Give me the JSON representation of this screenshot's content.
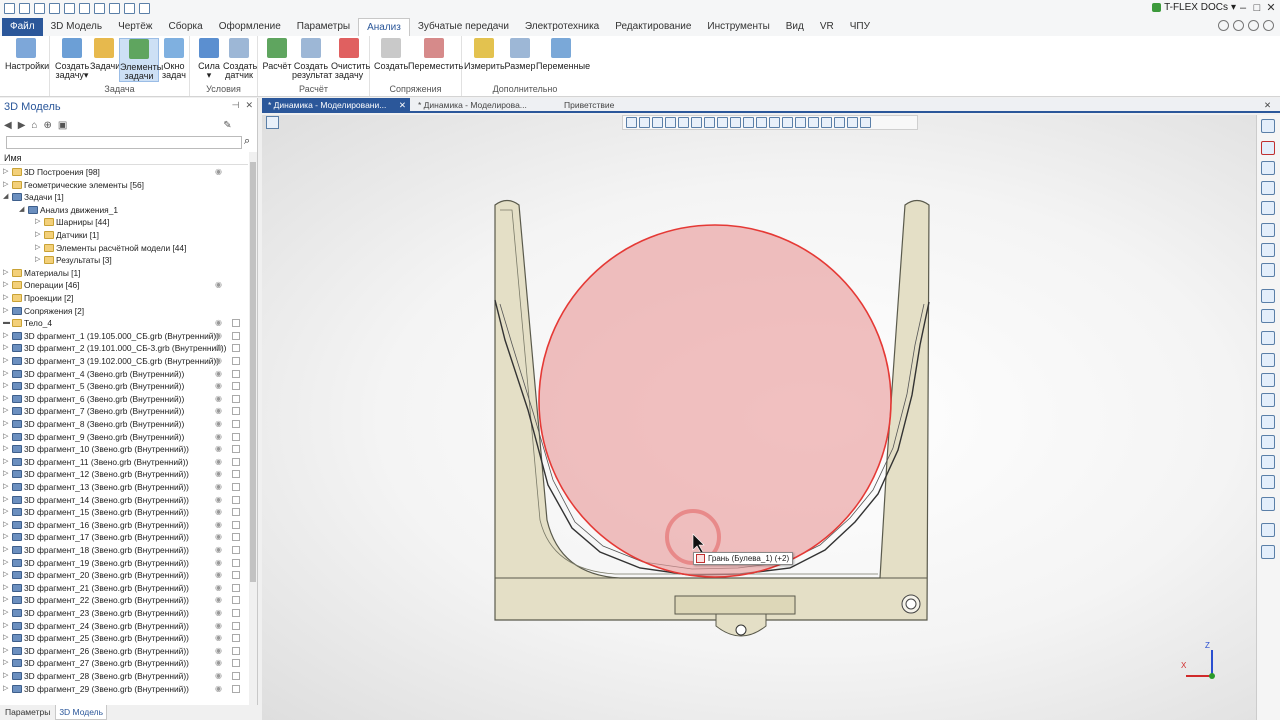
{
  "app": {
    "brand": "T-FLEX DOCs",
    "brand_arrow": "▾"
  },
  "menu_tabs": [
    "Файл",
    "3D Модель",
    "Чертёж",
    "Сборка",
    "Оформление",
    "Параметры",
    "Анализ",
    "Зубчатые передачи",
    "Электротехника",
    "Редактирование",
    "Инструменты",
    "Вид",
    "VR",
    "ЧПУ"
  ],
  "active_tab": "Анализ",
  "ribbon": {
    "settings": "Настройки",
    "create_task": "Создать задачу",
    "create_task_arrow": "▾",
    "tasks": "Задачи",
    "task_elements": "Элементы задачи",
    "task_window": "Окно задач",
    "group_task": "Задача",
    "force": "Сила",
    "force_arrow": "▾",
    "create_sensor": "Создать датчик",
    "group_conditions": "Условия",
    "calculation": "Расчёт",
    "create_result": "Создать результат",
    "clear_task": "Очистить задачу",
    "group_calc": "Расчёт",
    "create": "Создать",
    "move": "Переместить",
    "group_mates": "Сопряжения",
    "measure": "Измерить",
    "size": "Размер",
    "variables": "Переменные",
    "group_extra": "Дополнительно"
  },
  "left_panel": {
    "title": "3D Модель",
    "pin": "⊣",
    "close": "✕",
    "column_name": "Имя",
    "tree": [
      {
        "level": 0,
        "exp": "▷",
        "icon": "fold",
        "text": "3D Построения [98]",
        "eye": true,
        "doc": false
      },
      {
        "level": 0,
        "exp": "▷",
        "icon": "fold",
        "text": "Геометрические элементы [56]",
        "eye": false,
        "doc": false
      },
      {
        "level": 0,
        "exp": "◢",
        "icon": "frag",
        "text": "Задачи [1]",
        "eye": false,
        "doc": false
      },
      {
        "level": 1,
        "exp": "◢",
        "icon": "frag",
        "text": "Анализ движения_1",
        "eye": false,
        "doc": false
      },
      {
        "level": 2,
        "exp": "▷",
        "icon": "fold",
        "text": "Шарниры [44]",
        "eye": false,
        "doc": false
      },
      {
        "level": 2,
        "exp": "▷",
        "icon": "fold",
        "text": "Датчики [1]",
        "eye": false,
        "doc": false
      },
      {
        "level": 2,
        "exp": "▷",
        "icon": "fold",
        "text": "Элементы расчётной модели [44]",
        "eye": false,
        "doc": false
      },
      {
        "level": 2,
        "exp": "▷",
        "icon": "fold",
        "text": "Результаты [3]",
        "eye": false,
        "doc": false
      },
      {
        "level": 0,
        "exp": "▷",
        "icon": "fold",
        "text": "Материалы [1]",
        "eye": false,
        "doc": false
      },
      {
        "level": 0,
        "exp": "▷",
        "icon": "fold",
        "text": "Операции [46]",
        "eye": true,
        "doc": false
      },
      {
        "level": 0,
        "exp": "▷",
        "icon": "fold",
        "text": "Проекции [2]",
        "eye": false,
        "doc": false
      },
      {
        "level": 0,
        "exp": "▷",
        "icon": "frag",
        "text": "Сопряжения [2]",
        "eye": false,
        "doc": false
      },
      {
        "level": 0,
        "exp": "▬",
        "icon": "fold",
        "text": "Тело_4",
        "eye": true,
        "doc": true
      },
      {
        "level": 0,
        "exp": "▷",
        "icon": "frag",
        "text": "3D фрагмент_1 (19.105.000_СБ.grb (Внутренний))",
        "eye": true,
        "doc": true
      },
      {
        "level": 0,
        "exp": "▷",
        "icon": "frag",
        "text": "3D фрагмент_2 (19.101.000_СБ-3.grb (Внутренний))",
        "eye": true,
        "doc": true
      },
      {
        "level": 0,
        "exp": "▷",
        "icon": "frag",
        "text": "3D фрагмент_3 (19.102.000_СБ.grb (Внутренний))",
        "eye": true,
        "doc": true
      },
      {
        "level": 0,
        "exp": "▷",
        "icon": "frag",
        "text": "3D фрагмент_4 (Звено.grb (Внутренний))",
        "eye": true,
        "doc": true
      },
      {
        "level": 0,
        "exp": "▷",
        "icon": "frag",
        "text": "3D фрагмент_5 (Звено.grb (Внутренний))",
        "eye": true,
        "doc": true
      },
      {
        "level": 0,
        "exp": "▷",
        "icon": "frag",
        "text": "3D фрагмент_6 (Звено.grb (Внутренний))",
        "eye": true,
        "doc": true
      },
      {
        "level": 0,
        "exp": "▷",
        "icon": "frag",
        "text": "3D фрагмент_7 (Звено.grb (Внутренний))",
        "eye": true,
        "doc": true
      },
      {
        "level": 0,
        "exp": "▷",
        "icon": "frag",
        "text": "3D фрагмент_8 (Звено.grb (Внутренний))",
        "eye": true,
        "doc": true
      },
      {
        "level": 0,
        "exp": "▷",
        "icon": "frag",
        "text": "3D фрагмент_9 (Звено.grb (Внутренний))",
        "eye": true,
        "doc": true
      },
      {
        "level": 0,
        "exp": "▷",
        "icon": "frag",
        "text": "3D фрагмент_10 (Звено.grb (Внутренний))",
        "eye": true,
        "doc": true
      },
      {
        "level": 0,
        "exp": "▷",
        "icon": "frag",
        "text": "3D фрагмент_11 (Звено.grb (Внутренний))",
        "eye": true,
        "doc": true
      },
      {
        "level": 0,
        "exp": "▷",
        "icon": "frag",
        "text": "3D фрагмент_12 (Звено.grb (Внутренний))",
        "eye": true,
        "doc": true
      },
      {
        "level": 0,
        "exp": "▷",
        "icon": "frag",
        "text": "3D фрагмент_13 (Звено.grb (Внутренний))",
        "eye": true,
        "doc": true
      },
      {
        "level": 0,
        "exp": "▷",
        "icon": "frag",
        "text": "3D фрагмент_14 (Звено.grb (Внутренний))",
        "eye": true,
        "doc": true
      },
      {
        "level": 0,
        "exp": "▷",
        "icon": "frag",
        "text": "3D фрагмент_15 (Звено.grb (Внутренний))",
        "eye": true,
        "doc": true
      },
      {
        "level": 0,
        "exp": "▷",
        "icon": "frag",
        "text": "3D фрагмент_16 (Звено.grb (Внутренний))",
        "eye": true,
        "doc": true
      },
      {
        "level": 0,
        "exp": "▷",
        "icon": "frag",
        "text": "3D фрагмент_17 (Звено.grb (Внутренний))",
        "eye": true,
        "doc": true
      },
      {
        "level": 0,
        "exp": "▷",
        "icon": "frag",
        "text": "3D фрагмент_18 (Звено.grb (Внутренний))",
        "eye": true,
        "doc": true
      },
      {
        "level": 0,
        "exp": "▷",
        "icon": "frag",
        "text": "3D фрагмент_19 (Звено.grb (Внутренний))",
        "eye": true,
        "doc": true
      },
      {
        "level": 0,
        "exp": "▷",
        "icon": "frag",
        "text": "3D фрагмент_20 (Звено.grb (Внутренний))",
        "eye": true,
        "doc": true
      },
      {
        "level": 0,
        "exp": "▷",
        "icon": "frag",
        "text": "3D фрагмент_21 (Звено.grb (Внутренний))",
        "eye": true,
        "doc": true
      },
      {
        "level": 0,
        "exp": "▷",
        "icon": "frag",
        "text": "3D фрагмент_22 (Звено.grb (Внутренний))",
        "eye": true,
        "doc": true
      },
      {
        "level": 0,
        "exp": "▷",
        "icon": "frag",
        "text": "3D фрагмент_23 (Звено.grb (Внутренний))",
        "eye": true,
        "doc": true
      },
      {
        "level": 0,
        "exp": "▷",
        "icon": "frag",
        "text": "3D фрагмент_24 (Звено.grb (Внутренний))",
        "eye": true,
        "doc": true
      },
      {
        "level": 0,
        "exp": "▷",
        "icon": "frag",
        "text": "3D фрагмент_25 (Звено.grb (Внутренний))",
        "eye": true,
        "doc": true
      },
      {
        "level": 0,
        "exp": "▷",
        "icon": "frag",
        "text": "3D фрагмент_26 (Звено.grb (Внутренний))",
        "eye": true,
        "doc": true
      },
      {
        "level": 0,
        "exp": "▷",
        "icon": "frag",
        "text": "3D фрагмент_27 (Звено.grb (Внутренний))",
        "eye": true,
        "doc": true
      },
      {
        "level": 0,
        "exp": "▷",
        "icon": "frag",
        "text": "3D фрагмент_28 (Звено.grb (Внутренний))",
        "eye": true,
        "doc": true
      },
      {
        "level": 0,
        "exp": "▷",
        "icon": "frag",
        "text": "3D фрагмент_29 (Звено.grb (Внутренний))",
        "eye": true,
        "doc": true
      }
    ]
  },
  "bottom_tabs": [
    "Параметры",
    "3D Модель"
  ],
  "active_bottom_tab": "3D Модель",
  "doc_tabs": [
    {
      "label": "* Динамика - Моделировани...",
      "close": "✕",
      "active": true
    },
    {
      "label": "* Динамика - Моделирова...",
      "close": "",
      "active": false
    },
    {
      "label": "Приветствие",
      "close": "",
      "active": false
    }
  ],
  "viewport": {
    "tooltip": "Грань (Булева_1) (+2)",
    "axis_z": "Z",
    "axis_x": "X"
  },
  "colors": {
    "accent": "#2b579a",
    "sphere": "#e57373",
    "sphere_edge": "#e53935",
    "frame": "#e4dfc6",
    "frame_edge": "#5a5a4c"
  }
}
